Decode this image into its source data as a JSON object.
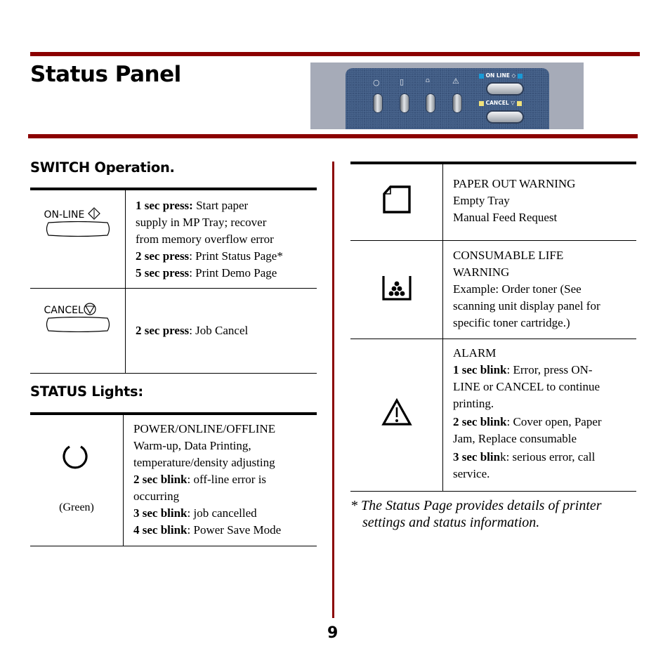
{
  "page": {
    "title": "Status Panel",
    "page_number": "9",
    "accent_color": "#8b0000"
  },
  "panel_image": {
    "online_label": "ON LINE",
    "cancel_label": "CANCEL",
    "online_indicator_color": "#1a9ad6",
    "cancel_indicator_color": "#f2e27a",
    "light_icons": [
      "power-icon",
      "paper-icon",
      "toner-icon",
      "alarm-icon"
    ]
  },
  "switch_section": {
    "heading": "SWITCH Operation.",
    "rows": [
      {
        "button_label": "ON-LINE",
        "icon": "online-diamond-icon",
        "lines": [
          {
            "bold": "1 sec press:",
            "text": " Start paper"
          },
          {
            "bold": "",
            "text": "supply in MP Tray; recover"
          },
          {
            "bold": "",
            "text": "from memory overflow error"
          },
          {
            "bold": "2 sec press",
            "text": ": Print Status Page*"
          },
          {
            "bold": "5 sec press",
            "text": ": Print Demo Page"
          }
        ]
      },
      {
        "button_label": "CANCEL",
        "icon": "cancel-triangle-icon",
        "lines": [
          {
            "bold": "2 sec press",
            "text": ": Job Cancel"
          }
        ]
      }
    ]
  },
  "status_section": {
    "heading": "STATUS Lights:",
    "power": {
      "icon": "power-icon",
      "caption": "(Green)",
      "lines": [
        {
          "bold": "",
          "text": "POWER/ONLINE/OFFLINE"
        },
        {
          "bold": "",
          "text": "Warm-up, Data Printing,"
        },
        {
          "bold": "",
          "text": "temperature/density adjusting"
        },
        {
          "bold": "2 sec blink",
          "text": ": off-line error is"
        },
        {
          "bold": "",
          "text": "occurring"
        },
        {
          "bold": "3 sec blink",
          "text": ": job cancelled"
        },
        {
          "bold": "4 sec blink",
          "text": ": Power Save Mode"
        }
      ]
    }
  },
  "right_table": {
    "rows": [
      {
        "icon": "paper-icon",
        "lines": [
          {
            "bold": "",
            "text": "PAPER OUT WARNING"
          },
          {
            "bold": "",
            "text": "Empty Tray"
          },
          {
            "bold": "",
            "text": "Manual Feed Request"
          }
        ]
      },
      {
        "icon": "toner-icon",
        "lines": [
          {
            "bold": "",
            "text": "CONSUMABLE LIFE"
          },
          {
            "bold": "",
            "text": "WARNING"
          },
          {
            "bold": "",
            "text": "Example: Order toner (See"
          },
          {
            "bold": "",
            "text": "scanning unit display panel for"
          },
          {
            "bold": "",
            "text": "specific toner cartridge.)"
          }
        ]
      },
      {
        "icon": "alarm-icon",
        "lines": [
          {
            "bold": "",
            "text": "ALARM"
          },
          {
            "bold": "1 sec blink",
            "text": ": Error, press ON-"
          },
          {
            "bold": "",
            "text": "LINE or CANCEL to continue"
          },
          {
            "bold": "",
            "text": "printing."
          },
          {
            "bold": "2 sec blink",
            "text": ": Cover open, Paper"
          },
          {
            "bold": "",
            "text": "Jam, Replace consumable"
          },
          {
            "bold": "3 sec blin",
            "text": "k: serious error, call"
          },
          {
            "bold": "",
            "text": "service."
          }
        ]
      }
    ],
    "footnote_line1": "* The Status Page provides details of printer",
    "footnote_line2": "settings and status information."
  }
}
